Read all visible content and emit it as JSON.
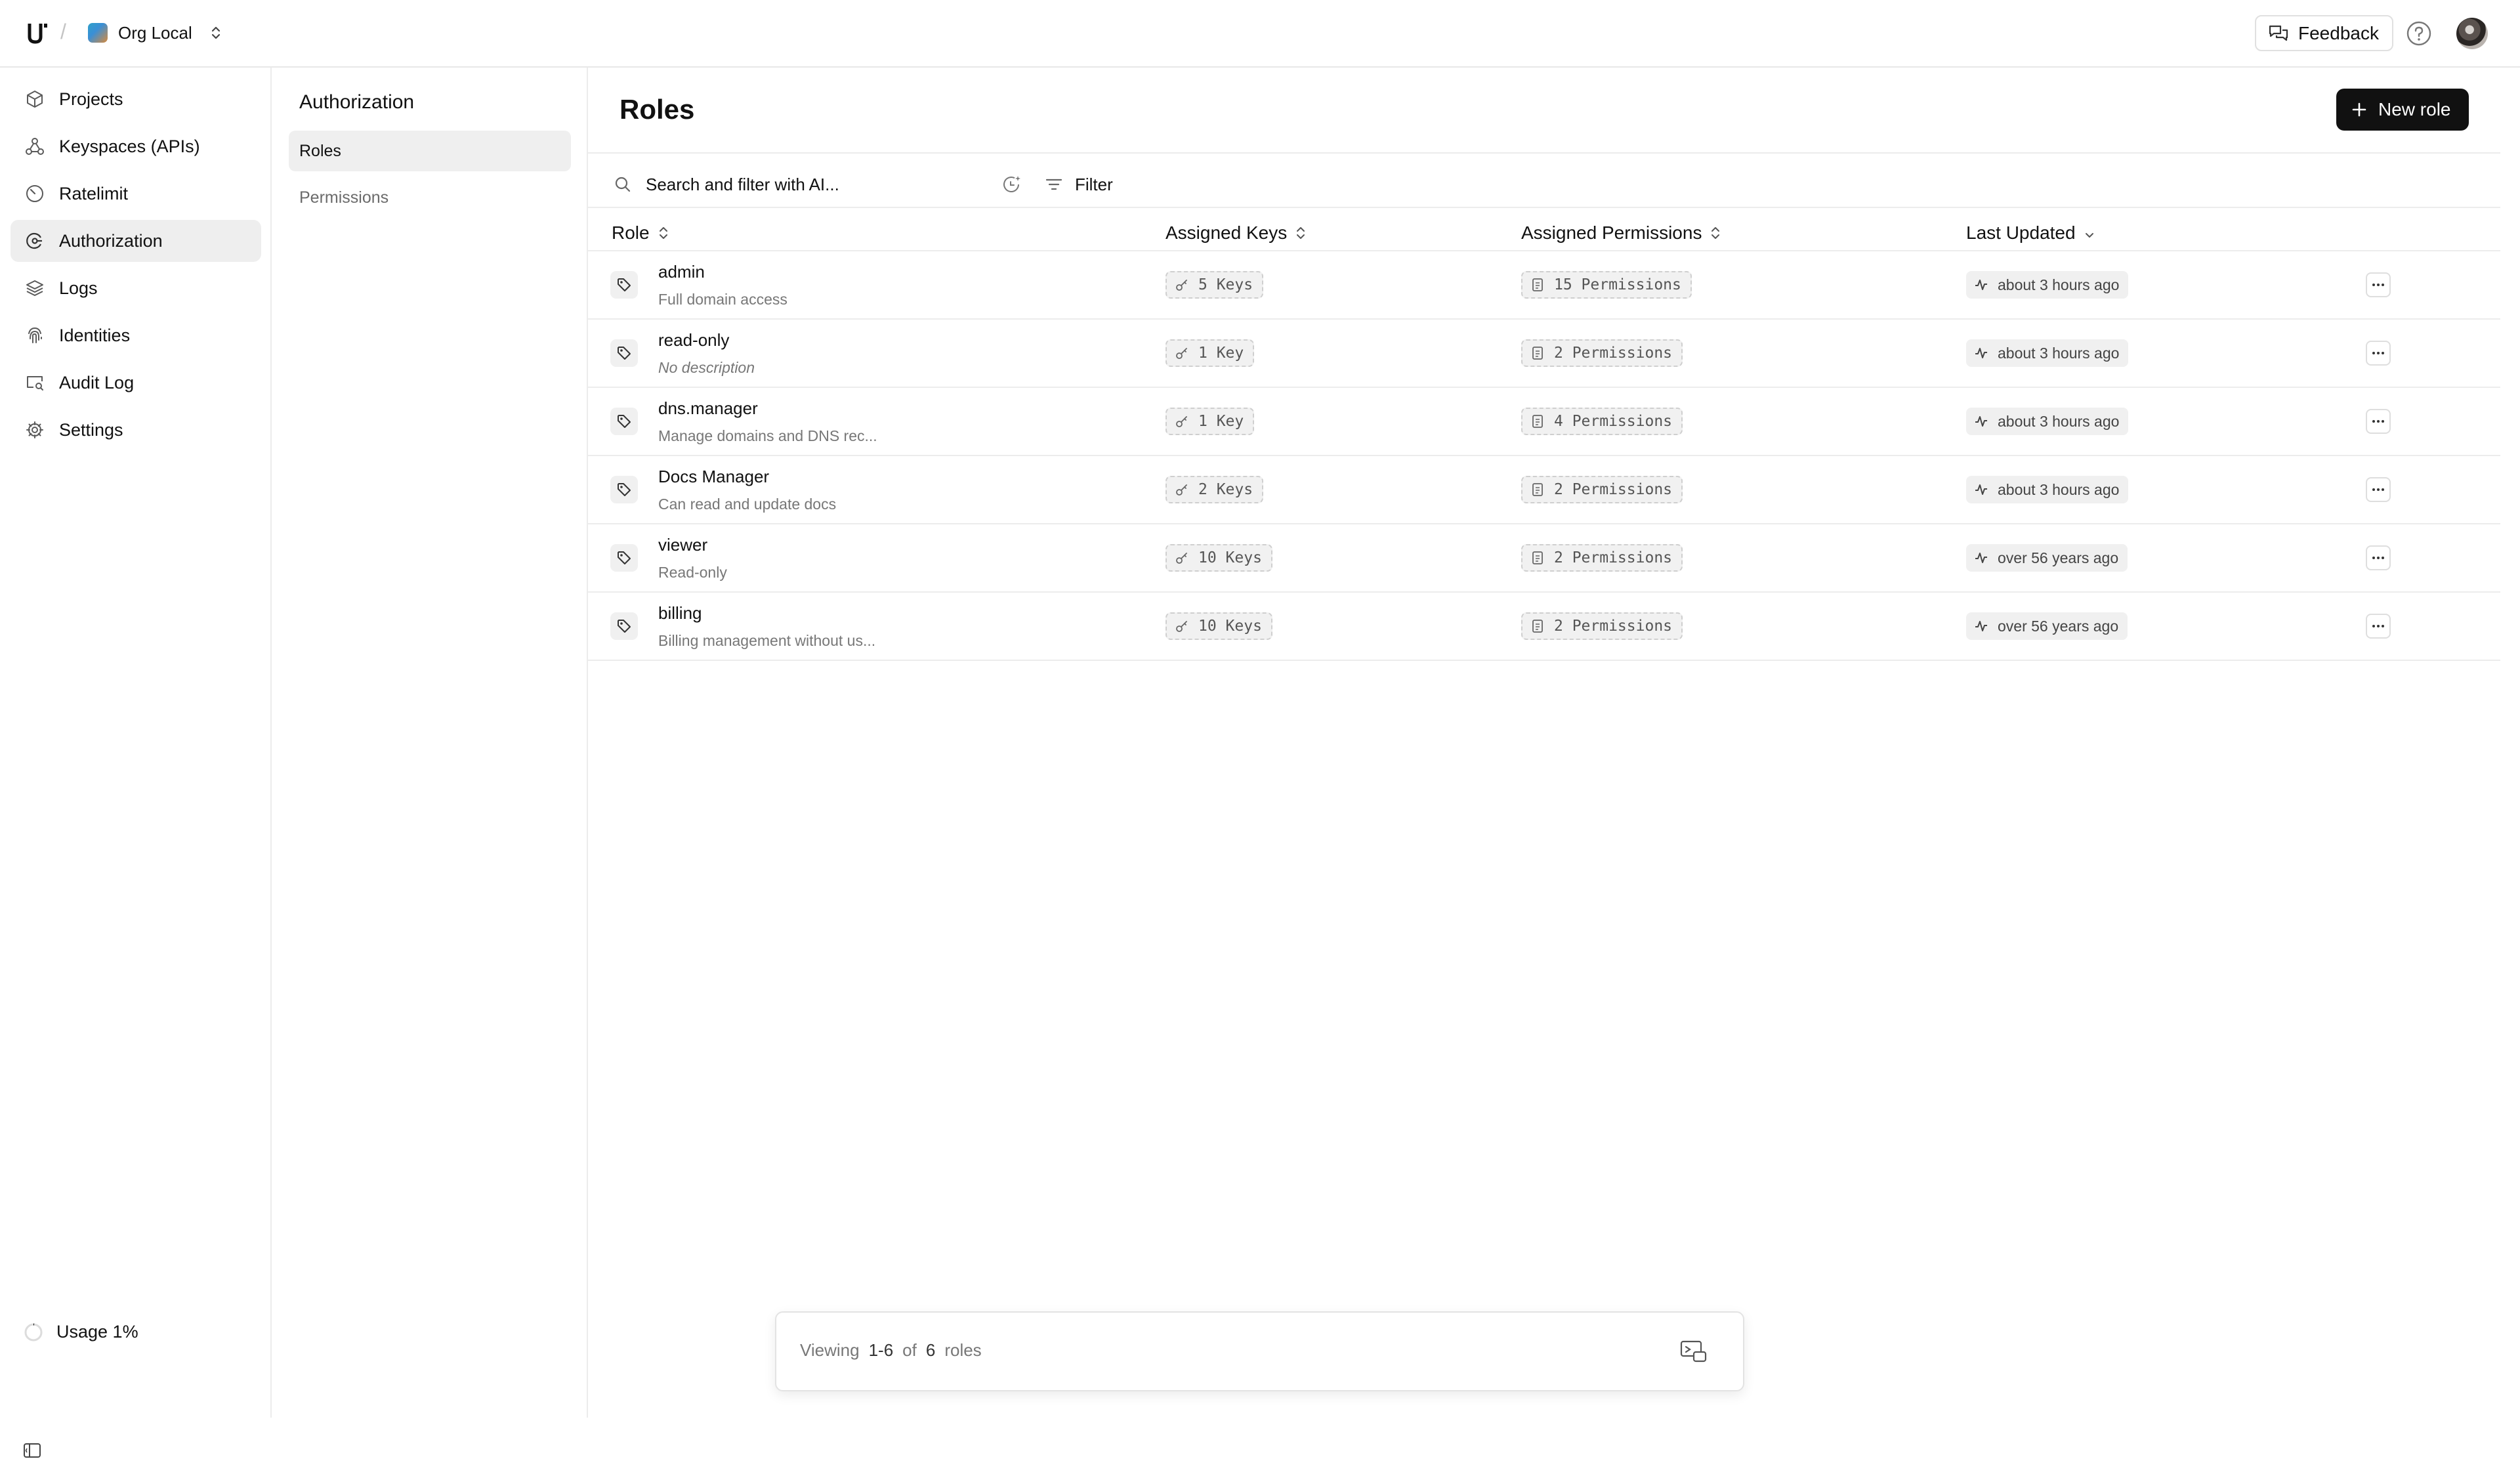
{
  "topbar": {
    "org_name": "Org Local",
    "feedback_label": "Feedback",
    "logo_icon": "unkey-logo-icon",
    "help_icon": "help-circle-icon"
  },
  "sidebar": {
    "items": [
      {
        "label": "Projects",
        "icon": "cube-icon"
      },
      {
        "label": "Keyspaces (APIs)",
        "icon": "nodes-icon"
      },
      {
        "label": "Ratelimit",
        "icon": "gauge-icon"
      },
      {
        "label": "Authorization",
        "icon": "shield-key-icon",
        "active": true
      },
      {
        "label": "Logs",
        "icon": "layers-icon"
      },
      {
        "label": "Identities",
        "icon": "fingerprint-icon"
      },
      {
        "label": "Audit Log",
        "icon": "monitor-search-icon"
      },
      {
        "label": "Settings",
        "icon": "gear-icon"
      }
    ],
    "usage_label": "Usage 1%"
  },
  "subnav": {
    "title": "Authorization",
    "items": [
      {
        "label": "Roles",
        "active": true
      },
      {
        "label": "Permissions"
      }
    ]
  },
  "main": {
    "title": "Roles",
    "new_role_label": "New role",
    "search_placeholder": "Search and filter with AI...",
    "filter_label": "Filter",
    "columns": {
      "role": "Role",
      "assigned_keys": "Assigned Keys",
      "assigned_permissions": "Assigned Permissions",
      "last_updated": "Last Updated"
    },
    "rows": [
      {
        "name": "admin",
        "description": "Full domain access",
        "keys": "5 Keys",
        "permissions": "15 Permissions",
        "updated": "about 3 hours ago"
      },
      {
        "name": "read-only",
        "description": "No description",
        "keys": "1 Key",
        "permissions": "2 Permissions",
        "updated": "about 3 hours ago"
      },
      {
        "name": "dns.manager",
        "description": "Manage domains and DNS rec...",
        "keys": "1 Key",
        "permissions": "4 Permissions",
        "updated": "about 3 hours ago"
      },
      {
        "name": "Docs Manager",
        "description": "Can read and update docs",
        "keys": "2 Keys",
        "permissions": "2 Permissions",
        "updated": "about 3 hours ago"
      },
      {
        "name": "viewer",
        "description": "Read-only",
        "keys": "10 Keys",
        "permissions": "2 Permissions",
        "updated": "over 56 years ago"
      },
      {
        "name": "billing",
        "description": "Billing management without us...",
        "keys": "10 Keys",
        "permissions": "2 Permissions",
        "updated": "over 56 years ago"
      }
    ]
  },
  "footer": {
    "viewing": "Viewing",
    "range": "1-6",
    "of": "of",
    "total": "6",
    "unit": "roles"
  }
}
